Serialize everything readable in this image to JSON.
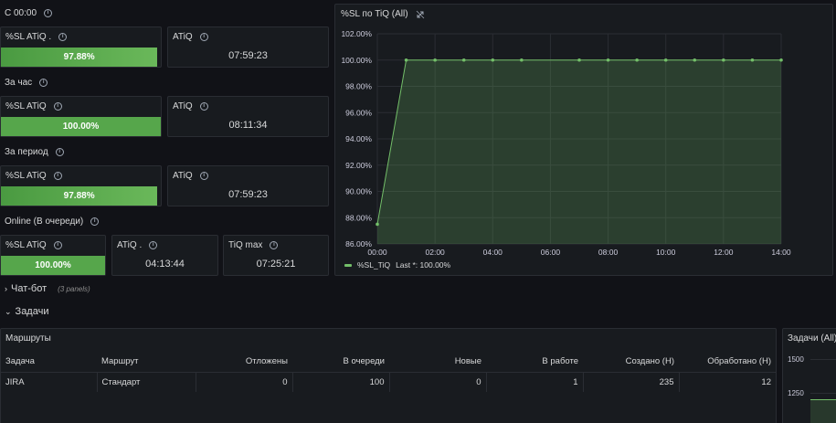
{
  "sections": {
    "since_midnight": "С 00:00",
    "last_hour": "За час",
    "period": "За период",
    "online": "Online (В очереди)"
  },
  "stats": {
    "s1_sl_title": "%SL ATiQ .",
    "s1_sl_value": "97.88%",
    "s1_sl_fill": 0.9788,
    "s1_atiq_title": "ATiQ",
    "s1_atiq_value": "07:59:23",
    "s2_sl_title": "%SL ATiQ",
    "s2_sl_value": "100.00%",
    "s2_sl_fill": 1.0,
    "s2_atiq_title": "ATiQ",
    "s2_atiq_value": "08:11:34",
    "s3_sl_title": "%SL ATiQ",
    "s3_sl_value": "97.88%",
    "s3_sl_fill": 0.9788,
    "s3_atiq_title": "ATiQ",
    "s3_atiq_value": "07:59:23",
    "s4_sl_title": "%SL ATiQ",
    "s4_sl_value": "100.00%",
    "s4_sl_fill": 1.0,
    "s4_atiq_title": "ATiQ .",
    "s4_atiq_value": "04:13:44",
    "s4_tiq_title": "TiQ max",
    "s4_tiq_value": "07:25:21"
  },
  "chart": {
    "title": "%SL по TiQ (All)",
    "legend_label": "%SL_TiQ",
    "legend_last": "Last *: 100.00%",
    "line_color": "#73bf69"
  },
  "chart_data": {
    "type": "area",
    "title": "%SL по TiQ (All)",
    "x_ticks": [
      "00:00",
      "02:00",
      "04:00",
      "06:00",
      "08:00",
      "10:00",
      "12:00",
      "14:00"
    ],
    "y_ticks": [
      "86.00%",
      "88.00%",
      "90.00%",
      "92.00%",
      "94.00%",
      "96.00%",
      "98.00%",
      "100.00%",
      "102.00%"
    ],
    "ylim": [
      86,
      102
    ],
    "xlim": [
      0,
      14
    ],
    "series": [
      {
        "name": "%SL_TiQ",
        "x": [
          0,
          1,
          2,
          3,
          4,
          5,
          7,
          8,
          9,
          10,
          11,
          12,
          13,
          14
        ],
        "values": [
          87.5,
          100,
          100,
          100,
          100,
          100,
          100,
          100,
          100,
          100,
          100,
          100,
          100,
          100
        ]
      }
    ],
    "grid": true,
    "legend_position": "bottom-left"
  },
  "rows": {
    "chatbot_label": "Чат-бот",
    "chatbot_count": "(3 panels)",
    "tasks_label": "Задачи"
  },
  "routes": {
    "title": "Маршруты",
    "headers": [
      "Задача",
      "Маршрут",
      "Отложены",
      "В очереди",
      "Новые",
      "В работе",
      "Создано (Н)",
      "Обработано (Н)"
    ],
    "row": [
      "JIRA",
      "Стандарт",
      "0",
      "100",
      "0",
      "1",
      "235",
      "12"
    ]
  },
  "tasks_panel": {
    "title": "Задачи (All)",
    "y_ticks": [
      "1500",
      "1250"
    ]
  }
}
